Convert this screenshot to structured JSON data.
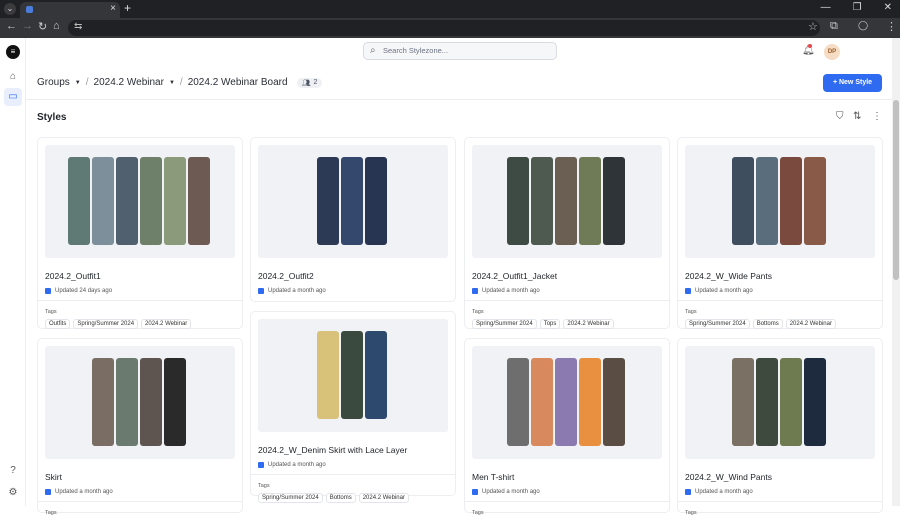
{
  "browser": {
    "tab_title": "",
    "window_minimize": "—",
    "window_restore": "❐",
    "window_close": "✕"
  },
  "search": {
    "placeholder": "Search Stylezone..."
  },
  "user": {
    "initials": "DP"
  },
  "breadcrumb": {
    "groups": "Groups",
    "webinar": "2024.2 Webinar",
    "board": "2024.2 Webinar Board",
    "member_count": "2"
  },
  "new_style_label": "New Style",
  "section_title": "Styles",
  "cards": [
    {
      "title": "2024.2_Outfit1",
      "updated": "Updated 24 days ago",
      "tags_label": "Tags",
      "tags": [
        "Outfits",
        "Spring/Summer 2024",
        "2024.2 Webinar"
      ]
    },
    {
      "title": "2024.2_Outfit2",
      "updated": "Updated a month ago",
      "tags_label": "",
      "tags": []
    },
    {
      "title": "2024.2_Outfit1_Jacket",
      "updated": "Updated a month ago",
      "tags_label": "Tags",
      "tags": [
        "Spring/Summer 2024",
        "Tops",
        "2024.2 Webinar"
      ]
    },
    {
      "title": "2024.2_W_Wide Pants",
      "updated": "Updated a month ago",
      "tags_label": "Tags",
      "tags": [
        "Spring/Summer 2024",
        "Bottoms",
        "2024.2 Webinar"
      ]
    },
    {
      "title": "Skirt",
      "updated": "Updated a month ago",
      "tags_label": "Tags",
      "tags": []
    },
    {
      "title": "2024.2_W_Denim Skirt with Lace Layer",
      "updated": "Updated a month ago",
      "tags_label": "Tags",
      "tags": [
        "Spring/Summer 2024",
        "Bottoms",
        "2024.2 Webinar"
      ]
    },
    {
      "title": "Men T-shirt",
      "updated": "Updated a month ago",
      "tags_label": "Tags",
      "tags": []
    },
    {
      "title": "2024.2_W_Wind Pants",
      "updated": "Updated a month ago",
      "tags_label": "Tags",
      "tags": []
    }
  ]
}
